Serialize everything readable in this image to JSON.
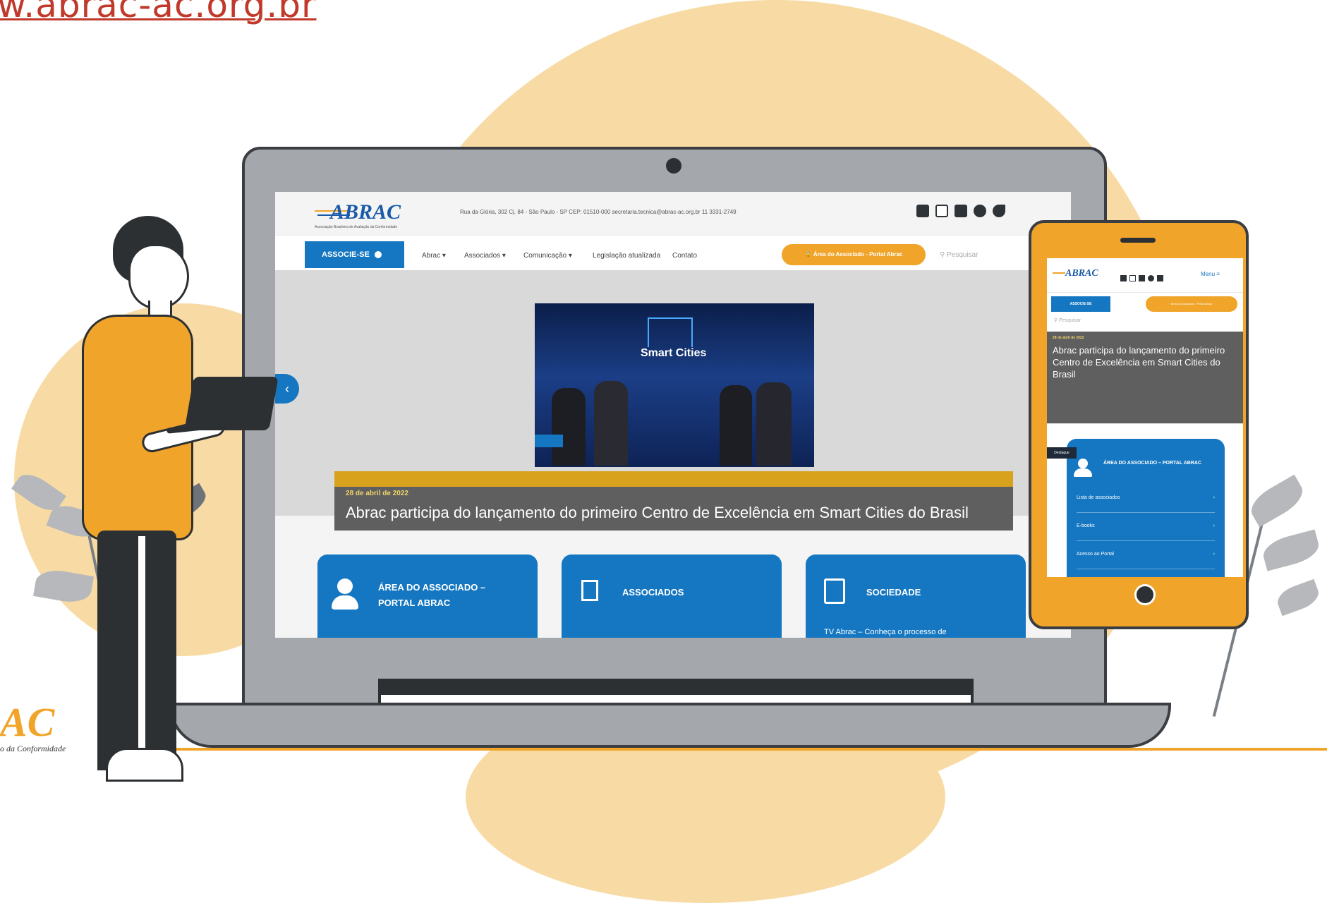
{
  "page": {
    "url_text": "w.abrac-ac.org.br",
    "bottom_logo": "AC",
    "bottom_tagline": "o da Conformidade"
  },
  "colors": {
    "accent_orange": "#f0a52a",
    "brand_blue": "#1577c1",
    "blob": "#f8dba4"
  },
  "site": {
    "logo": "ABRAC",
    "logo_tagline": "Associação Brasileira de Avaliação da Conformidade",
    "contact": "Rua da Glória, 302 Cj. 84 - São Paulo - SP CEP: 01510-000   secretaria.tecnica@abrac-ac.org.br   11 3331-2749",
    "social_icons": [
      "linkedin-icon",
      "instagram-icon",
      "youtube-icon",
      "facebook-icon",
      "twitter-icon"
    ],
    "nav": {
      "associe_button": "ASSOCIE-SE",
      "items": [
        "Abrac ▾",
        "Associados ▾",
        "Comunicação ▾",
        "Legislação atualizada",
        "Contato"
      ],
      "portal_button": "Área do Associado - Portal Abrac",
      "search_placeholder": "Pesquisar"
    },
    "hero": {
      "image_text": "Smart Cities",
      "date": "28 de abril de 2022",
      "title": "Abrac participa do lançamento do primeiro Centro de Excelência em Smart Cities do Brasil"
    },
    "cards": [
      {
        "title": "ÁREA DO ASSOCIADO – PORTAL ABRAC",
        "icon": "user-check-icon"
      },
      {
        "title": "ASSOCIADOS",
        "icon": "building-icon"
      },
      {
        "title": "SOCIEDADE",
        "icon": "document-pen-icon",
        "text": "TV Abrac – Conheça o processo de"
      }
    ]
  },
  "mobile": {
    "menu_label": "Menu",
    "associe_button": "ASSOCIE-SE",
    "portal_button": "Área do Associado - Portal Abrac",
    "search_placeholder": "Pesquisar",
    "hero_date": "28 de abril de 2022",
    "hero_title": "Abrac participa do lançamento do primeiro Centro de Excelência em Smart Cities do Brasil",
    "card_tag": "Destaque",
    "card_title": "ÁREA DO ASSOCIADO – PORTAL ABRAC",
    "card_rows": [
      "Lista de associados",
      "E-books",
      "Acesso ao Portal"
    ]
  }
}
